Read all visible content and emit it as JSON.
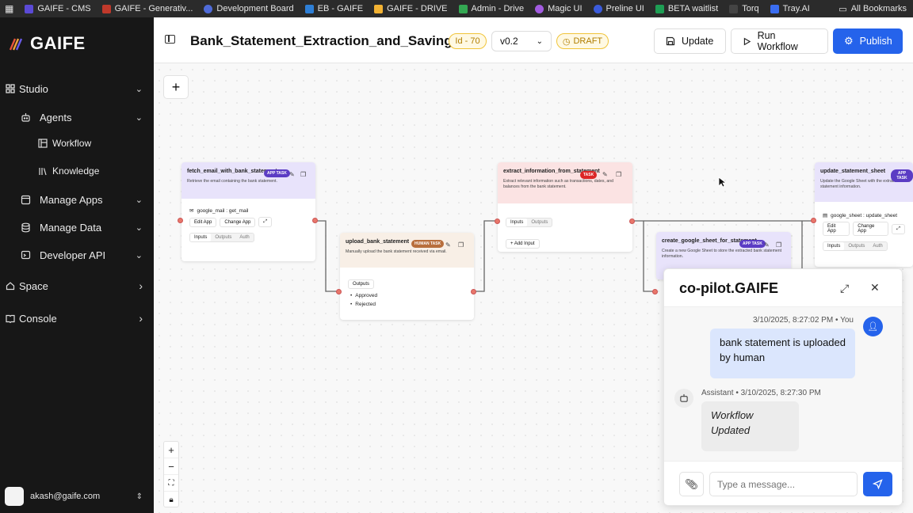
{
  "bookmarks": [
    {
      "label": "GAIFE - CMS",
      "color": "#5b4ad6"
    },
    {
      "label": "GAIFE - Generativ...",
      "color": "#c0392b"
    },
    {
      "label": "Development Board",
      "color": "#4f6bd8"
    },
    {
      "label": "EB - GAIFE",
      "color": "#2e7fd6"
    },
    {
      "label": "GAIFE - DRIVE",
      "color": "#f2b233"
    },
    {
      "label": "Admin - Drive",
      "color": "#34a853"
    },
    {
      "label": "Magic UI",
      "color": "#a25be0"
    },
    {
      "label": "Preline UI",
      "color": "#3b5bdb"
    },
    {
      "label": "BETA waitlist",
      "color": "#1e9e54"
    },
    {
      "label": "Torq",
      "color": "#444444"
    },
    {
      "label": "Tray.AI",
      "color": "#3a6df0"
    }
  ],
  "all_bookmarks": "All Bookmarks",
  "sidebar": {
    "logo": "GAIFE",
    "items": [
      {
        "label": "Studio",
        "icon": "grid-icon",
        "chev": "⌄"
      },
      {
        "label": "Agents",
        "icon": "bot-icon",
        "chev": "⌄"
      },
      {
        "label": "Workflow",
        "icon": "layout-icon",
        "chev": ""
      },
      {
        "label": "Knowledge",
        "icon": "library-icon",
        "chev": ""
      },
      {
        "label": "Manage Apps",
        "icon": "app-window-icon",
        "chev": "⌄"
      },
      {
        "label": "Manage Data",
        "icon": "database-icon",
        "chev": "⌄"
      },
      {
        "label": "Developer API",
        "icon": "code-window-icon",
        "chev": "⌄"
      },
      {
        "label": "Space",
        "icon": "home-icon",
        "chev": "›"
      },
      {
        "label": "Console",
        "icon": "book-icon",
        "chev": "›"
      }
    ],
    "user": "akash@gaife.com"
  },
  "header": {
    "title": "Bank_Statement_Extraction_and_Saving",
    "id_badge": "Id - 70",
    "version": "v0.2",
    "status": "DRAFT",
    "update_label": "Update",
    "run_label": "Run Workflow",
    "publish_label": "Publish"
  },
  "nodes": {
    "fetch": {
      "title": "fetch_email_with_bank_statement",
      "tag": "APP TASK",
      "desc": "Retrieve the email containing the bank statement.",
      "app": "google_mail : get_mail",
      "edit": "Edit App",
      "change": "Change App",
      "tabs": [
        "Inputs",
        "Outputs",
        "Auth"
      ]
    },
    "upload": {
      "title": "upload_bank_statement",
      "tag": "HUMAN TASK",
      "desc": "Manually upload the bank statement received via email.",
      "outputs": "Outputs",
      "opt1": "Approved",
      "opt2": "Rejected"
    },
    "extract": {
      "title": "extract_information_from_statement",
      "tag": "TASK",
      "desc": "Extract relevant information such as transactions, dates, and balances from the bank statement.",
      "tabs": [
        "Inputs",
        "Outputs"
      ],
      "add_input": "Add Input"
    },
    "create": {
      "title": "create_google_sheet_for_statement",
      "tag": "APP TASK",
      "desc": "Create a new Google Sheet to store the extracted bank statement information."
    },
    "update": {
      "title": "update_statement_sheet",
      "tag": "APP TASK",
      "desc": "Update the Google Sheet with the extracted bank statement information.",
      "app": "google_sheet : update_sheet",
      "edit": "Edit App",
      "change": "Change App",
      "tabs": [
        "Inputs",
        "Outputs",
        "Auth"
      ]
    }
  },
  "chat": {
    "title": "co-pilot.GAIFE",
    "user_meta": "3/10/2025, 8:27:02 PM  •  You",
    "user_msg": "bank statement is uploaded by human",
    "assistant_meta": "Assistant  •  3/10/2025, 8:27:30 PM",
    "assistant_msg": "Workflow Updated",
    "placeholder": "Type a message..."
  },
  "colors": {
    "accent": "#2563eb",
    "task_red": "#dc2626",
    "app_purple": "#5b3cc4",
    "human_brown": "#b86e3c"
  }
}
